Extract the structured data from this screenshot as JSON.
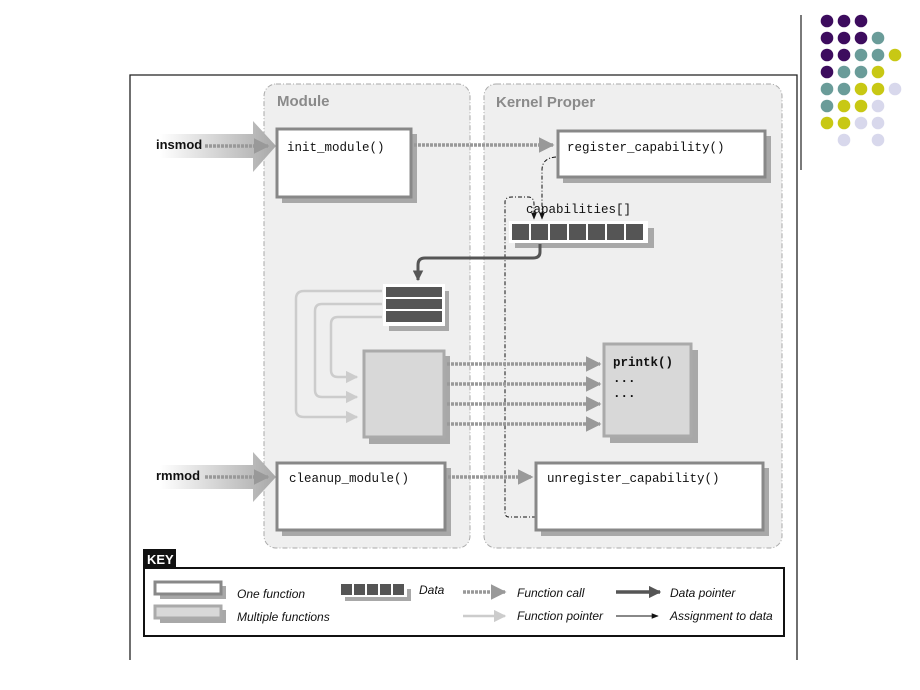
{
  "decoration": {
    "dot_colors": {
      "purple": "#3d0c5e",
      "teal": "#6a9c99",
      "yellow": "#c8c814",
      "lavender": "#d8d8ec"
    },
    "dot_grid": [
      [
        "purple",
        "purple",
        "purple",
        null,
        null
      ],
      [
        "purple",
        "purple",
        "purple",
        "teal",
        null
      ],
      [
        "purple",
        "purple",
        "teal",
        "teal",
        "yellow"
      ],
      [
        "purple",
        "teal",
        "teal",
        "yellow",
        null
      ],
      [
        "teal",
        "teal",
        "yellow",
        "yellow",
        "lavender"
      ],
      [
        "teal",
        "yellow",
        "yellow",
        "lavender",
        null
      ],
      [
        "yellow",
        "yellow",
        "lavender",
        "lavender",
        null
      ],
      [
        null,
        "lavender",
        null,
        "lavender",
        null
      ]
    ]
  },
  "diagram": {
    "module_panel": {
      "title": "Module"
    },
    "kernel_panel": {
      "title": "Kernel Proper"
    },
    "commands": {
      "insmod": "insmod",
      "rmmod": "rmmod"
    },
    "functions": {
      "init_module": "init_module()",
      "register_capability": "register_capability()",
      "capabilities": "capabilities[]",
      "printk": "printk()",
      "printk_more1": "...",
      "printk_more2": "...",
      "cleanup_module": "cleanup_module()",
      "unregister_capability": "unregister_capability()"
    },
    "colors": {
      "box_border": "#888888",
      "shadow": "#a8a8a8",
      "data_cell": "#555555",
      "panel_fill": "#efefef",
      "multi_fill": "#d8d8d8",
      "pointer_light": "#cccccc"
    }
  },
  "key": {
    "title": "KEY",
    "items": {
      "one_function": "One function",
      "multiple_functions": "Multiple functions",
      "data": "Data",
      "function_call": "Function call",
      "function_pointer": "Function pointer",
      "data_pointer": "Data pointer",
      "assignment": "Assignment to data"
    }
  }
}
